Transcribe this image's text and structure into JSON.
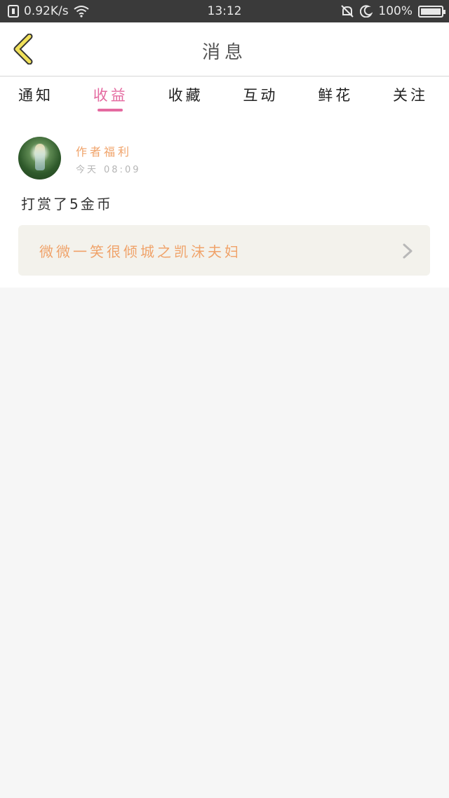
{
  "status_bar": {
    "speed": "0.92K/s",
    "time": "13:12",
    "battery": "100%"
  },
  "header": {
    "title": "消息"
  },
  "tabs": [
    {
      "label": "通知",
      "active": false
    },
    {
      "label": "收益",
      "active": true
    },
    {
      "label": "收藏",
      "active": false
    },
    {
      "label": "互动",
      "active": false
    },
    {
      "label": "鲜花",
      "active": false
    },
    {
      "label": "关注",
      "active": false
    }
  ],
  "post": {
    "author": "作者福利",
    "time_day": "今天",
    "time_clock": "08:09",
    "message": "打赏了5金币",
    "book_title": "微微一笑很倾城之凯沫夫妇"
  },
  "colors": {
    "accent": "#e46aa0",
    "orange_text": "#f0a36a",
    "status_bar_bg": "#3a3a3a",
    "back_arrow": "#f1e15a"
  },
  "icons": [
    "notification-icon",
    "wifi-icon",
    "mute-icon",
    "moon-icon",
    "battery-icon",
    "back-arrow-icon",
    "chevron-right-icon"
  ]
}
